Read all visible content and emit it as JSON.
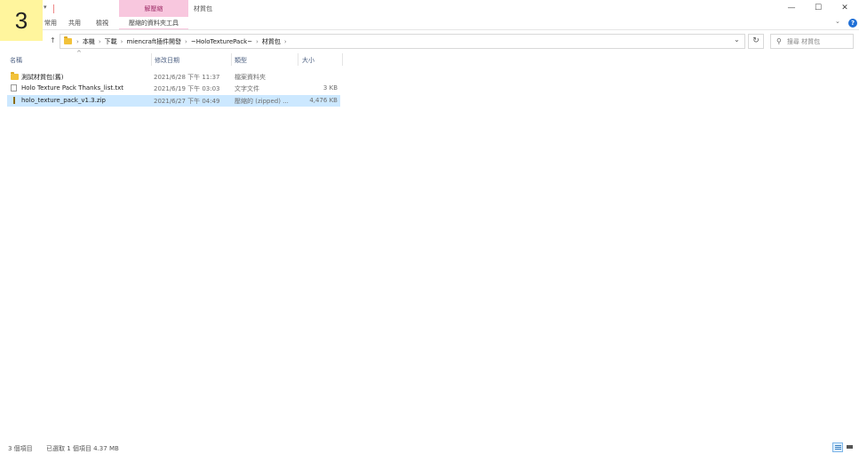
{
  "step_badge": "3",
  "title_bar": {
    "context_tab": "解壓縮",
    "window_title": "材質包",
    "minimize": "—",
    "maximize": "☐",
    "close": "✕"
  },
  "ribbon": {
    "tabs": [
      "常用",
      "共用",
      "檢視"
    ],
    "context_subtab": "壓縮的資料夾工具"
  },
  "address": {
    "crumbs": [
      "本機",
      "下載",
      "miencraft插件開發",
      "~HoloTexturePack~",
      "材質包"
    ],
    "search_placeholder": "搜尋 材質包"
  },
  "columns": {
    "name": "名稱",
    "date": "修改日期",
    "type": "類型",
    "size": "大小"
  },
  "rows": [
    {
      "name": "測試材質包(舊)",
      "date": "2021/6/28 下午 11:37",
      "type": "檔案資料夾",
      "size": "",
      "icon": "folder-icon"
    },
    {
      "name": "Holo Texture Pack Thanks_list.txt",
      "date": "2021/6/19 下午 03:03",
      "type": "文字文件",
      "size": "3 KB",
      "icon": "text-file-icon"
    },
    {
      "name": "holo_texture_pack_v1.3.zip",
      "date": "2021/6/27 下午 04:49",
      "type": "壓縮的 (zipped) ...",
      "size": "4,476 KB",
      "icon": "zip-file-icon"
    }
  ],
  "status_bar": {
    "count": "3 個項目",
    "selected": "已選取 1 個項目 4.37 MB"
  },
  "colors": {
    "context_tab_bg": "#f8c7de",
    "selection_bg": "#cce8ff",
    "help_blue": "#1f6fd6"
  }
}
